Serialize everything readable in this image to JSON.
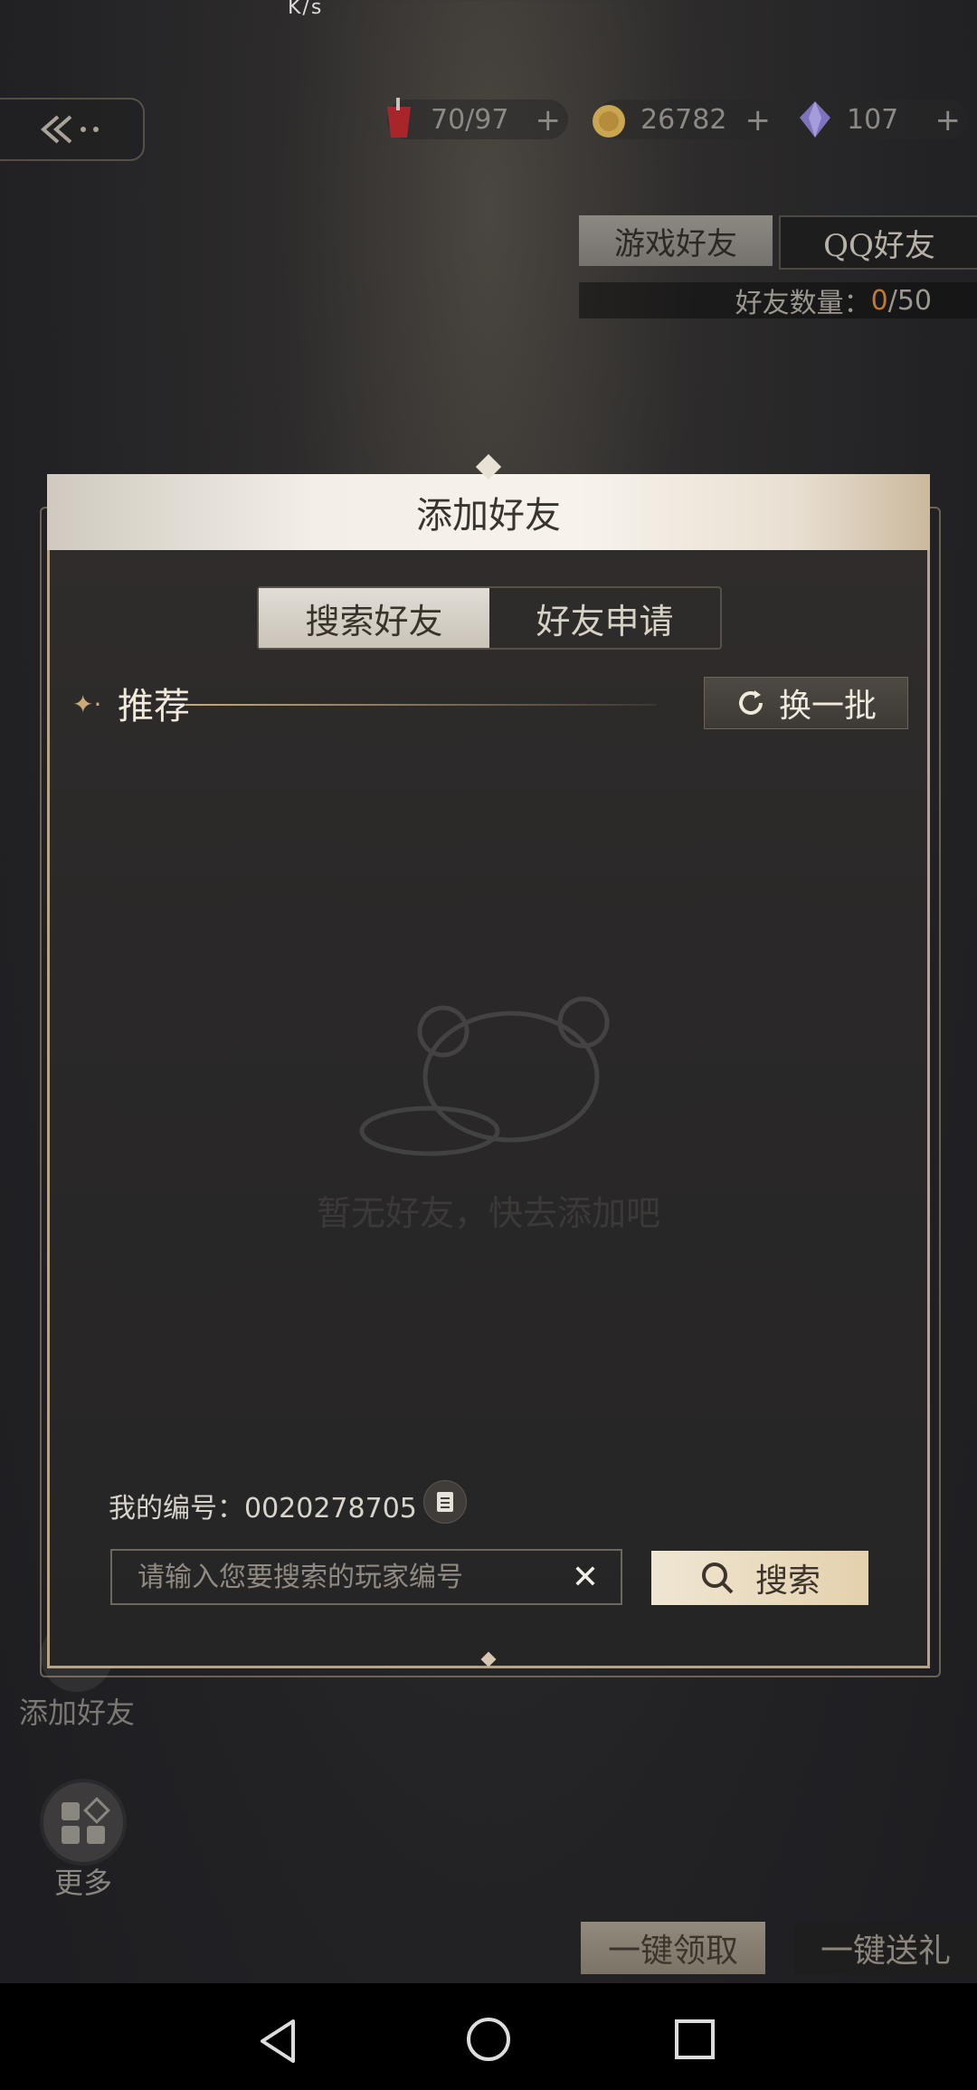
{
  "status_bar": {
    "speed": "K/s"
  },
  "header": {
    "back_icon": "back-arrow-icon",
    "resources": [
      {
        "name": "stamina",
        "icon": "drink-icon",
        "value": "70/97",
        "color": "#b3262a"
      },
      {
        "name": "gold",
        "icon": "coin-icon",
        "value": "26782",
        "color": "#d2a64a"
      },
      {
        "name": "gems",
        "icon": "crystal-icon",
        "value": "107",
        "color": "#8a80c9"
      }
    ],
    "plus_label": "+"
  },
  "friend_tabs": {
    "game": "游戏好友",
    "qq": "QQ好友",
    "count_label": "好友数量：",
    "count_value": "0",
    "count_max": "/50"
  },
  "side_menu": {
    "add_friend": "添加好友",
    "more": "更多"
  },
  "bottom_actions": {
    "claim_all": "一键领取",
    "gift_all": "一键送礼"
  },
  "modal": {
    "title": "添加好友",
    "tabs": [
      {
        "label": "搜索好友",
        "active": true
      },
      {
        "label": "好友申请",
        "active": false
      }
    ],
    "recommend_title": "推荐",
    "refresh_label": "换一批",
    "empty_text": "暂无好友，快去添加吧",
    "my_id_label": "我的编号：",
    "my_id": "0020278705",
    "search": {
      "placeholder": "请输入您要搜索的玩家编号",
      "value": "",
      "button": "搜索"
    }
  },
  "colors": {
    "accent": "#caa97a",
    "count_highlight": "#c17a34"
  }
}
